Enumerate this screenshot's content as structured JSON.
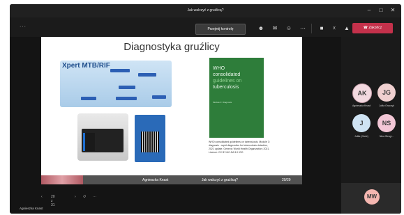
{
  "window": {
    "title": "Jak walczyć z gruźlicą?"
  },
  "toolbar": {
    "more_left": "···",
    "preview_button": "Przejmij kontrolę",
    "end_button": "Zakończ"
  },
  "slide": {
    "title": "Diagnostyka gruźlicy",
    "xpert_label": "Xpert MTB/RIF",
    "cover_lines": [
      "WHO",
      "consolidated",
      "guidelines on",
      "tuberculosis"
    ],
    "cover_module": "Module 3: Diagnosis",
    "caption": "WHO consolidated guidelines on tuberculosis. Module 3: diagnosis - rapid diagnostics for tuberculosis detection, 2021 update. Geneva: World Health Organization; 2021. Licence: CC BY-NC-SA 3.0 IGO",
    "footer_author": "Agnieszka Knast",
    "footer_title": "Jak walczyć z gruźlicą?",
    "footer_page": "20/29"
  },
  "nav": {
    "page": "20 z 31"
  },
  "presenter_name": "Agnieszka Knast",
  "participants": [
    {
      "initials": "AK",
      "name": "Agnieszka Knast",
      "color": "#f3d9e0"
    },
    {
      "initials": "JG",
      "name": "Julita Graczyk",
      "color": "#f0d0d0"
    },
    {
      "initials": "J",
      "name": "Julita (Gość)",
      "color": "#cfe3f3"
    },
    {
      "initials": "NS",
      "name": "Nina Strugi...",
      "color": "#f3c7d6"
    }
  ],
  "self": {
    "initials": "MW",
    "color": "#f4b6b0"
  },
  "icons": [
    "people-icon",
    "chat-icon",
    "reactions-icon",
    "more-icon",
    "camera-icon",
    "mic-off-icon",
    "share-icon",
    "phone-icon"
  ]
}
